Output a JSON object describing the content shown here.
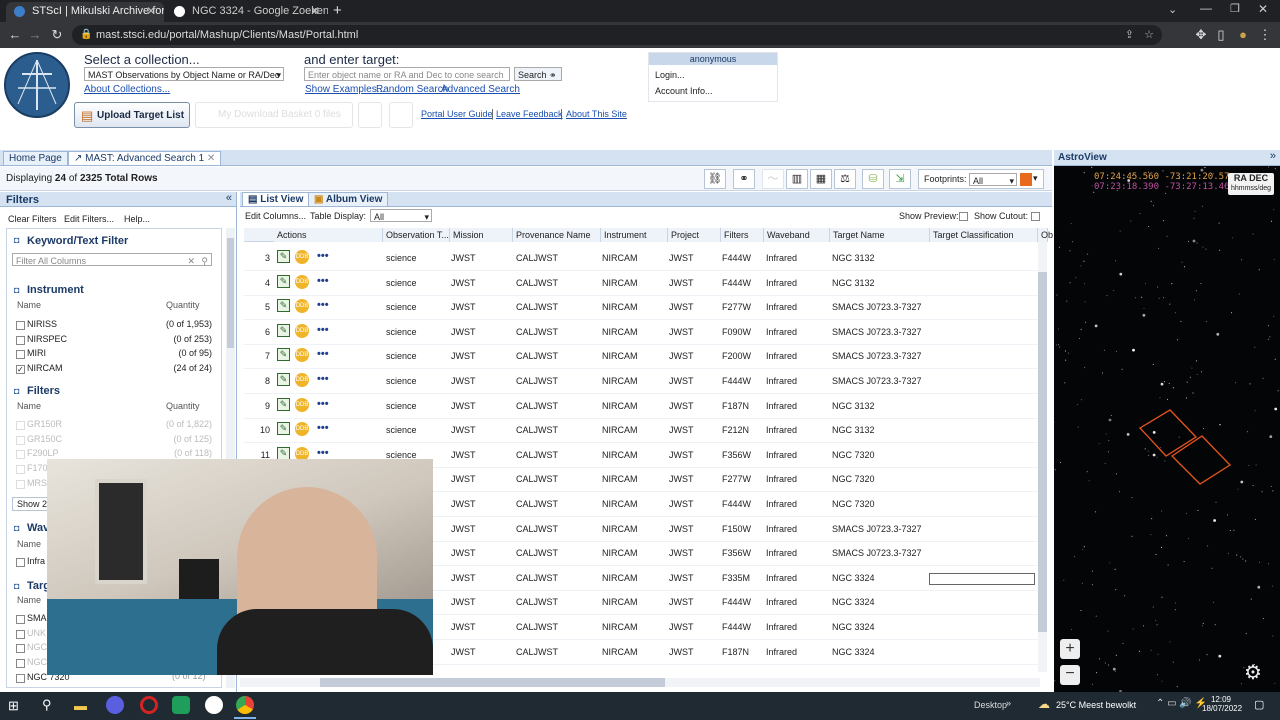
{
  "browser": {
    "tabs": [
      {
        "title": "STScI | Mikulski Archive for Spac",
        "color": "#3d7ec9"
      },
      {
        "title": "NGC 3324 - Google Zoeken",
        "color": "#fff"
      }
    ],
    "url": "mast.stsci.edu/portal/Mashup/Clients/Mast/Portal.html"
  },
  "header": {
    "select_collection_label": "Select a collection...",
    "collection_value": "MAST Observations by Object Name or RA/Dec",
    "about_collections": "About Collections...",
    "enter_target_label": "and enter target:",
    "target_placeholder": "Enter object name or RA and Dec to cone search",
    "search_button": "Search",
    "show_examples": "Show Examples...",
    "random_search": "Random Search",
    "advanced_search": "Advanced Search",
    "upload_button": "Upload Target List",
    "download_basket": "My Download Basket",
    "basket_count": "0 files",
    "links": [
      "Portal User Guide",
      "Leave Feedback",
      "About This Site"
    ],
    "account": {
      "user": "anonymous",
      "login": "Login...",
      "account_info": "Account Info..."
    }
  },
  "tabs": {
    "home": "Home Page",
    "search": "MAST: Advanced Search 1"
  },
  "results": {
    "display_prefix": "Displaying",
    "shown": "24",
    "of": "of",
    "total": "2325",
    "suffix": "Total Rows",
    "footprints_label": "Footprints:",
    "footprints_value": "All"
  },
  "filters": {
    "title": "Filters",
    "clear": "Clear Filters",
    "edit": "Edit Filters...",
    "help": "Help...",
    "keyword_title": "Keyword/Text Filter",
    "keyword_placeholder": "Filter All Columns",
    "name_label": "Name",
    "quantity_label": "Quantity",
    "instrument_title": "Instrument",
    "instruments": [
      {
        "name": "NIRISS",
        "qty": "(0 of 1,953)",
        "checked": false
      },
      {
        "name": "NIRSPEC",
        "qty": "(0 of 253)",
        "checked": false
      },
      {
        "name": "MIRI",
        "qty": "(0 of 95)",
        "checked": false
      },
      {
        "name": "NIRCAM",
        "qty": "(24 of 24)",
        "checked": true
      }
    ],
    "filters_title": "Filters",
    "filter_items": [
      {
        "name": "GR150R",
        "qty": "(0 of 1,822)"
      },
      {
        "name": "GR150C",
        "qty": "(0 of 125)"
      },
      {
        "name": "F290LP",
        "qty": "(0 of 118)"
      },
      {
        "name": "F170",
        "qty": ""
      },
      {
        "name": "MRS",
        "qty": ""
      }
    ],
    "show_more": "Show 2",
    "waveband_title": "Wav",
    "waveband_item": "Infra",
    "target_title": "Targ",
    "target_items": [
      "SMAC",
      "UNK",
      "NGC",
      "NGC",
      "NGC 7320"
    ],
    "target_qty": "(0 of 12)"
  },
  "grid": {
    "list_view": "List View",
    "album_view": "Album View",
    "edit_columns": "Edit Columns...",
    "table_display": "Table Display:",
    "table_display_value": "All",
    "show_preview": "Show Preview:",
    "show_cutout": "Show Cutout:",
    "columns": [
      "Actions",
      "Observation T...",
      "Mission",
      "Provenance Name",
      "Instrument",
      "Project",
      "Filters",
      "Waveband",
      "Target Name",
      "Target Classification",
      "Ob"
    ],
    "rows": [
      {
        "n": "3",
        "type": "science",
        "mission": "JWST",
        "prov": "CALJWST",
        "inst": "NIRCAM",
        "proj": "JWST",
        "filt": "F444W",
        "wave": "Infrared",
        "target": "NGC 3132"
      },
      {
        "n": "4",
        "type": "science",
        "mission": "JWST",
        "prov": "CALJWST",
        "inst": "NIRCAM",
        "proj": "JWST",
        "filt": "F444W",
        "wave": "Infrared",
        "target": "NGC 3132"
      },
      {
        "n": "5",
        "type": "science",
        "mission": "JWST",
        "prov": "CALJWST",
        "inst": "NIRCAM",
        "proj": "JWST",
        "filt": "F277W",
        "wave": "Infrared",
        "target": "SMACS J0723.3-7327"
      },
      {
        "n": "6",
        "type": "science",
        "mission": "JWST",
        "prov": "CALJWST",
        "inst": "NIRCAM",
        "proj": "JWST",
        "filt": "F090W",
        "wave": "Infrared",
        "target": "SMACS J0723.3-7327"
      },
      {
        "n": "7",
        "type": "science",
        "mission": "JWST",
        "prov": "CALJWST",
        "inst": "NIRCAM",
        "proj": "JWST",
        "filt": "F200W",
        "wave": "Infrared",
        "target": "SMACS J0723.3-7327"
      },
      {
        "n": "8",
        "type": "science",
        "mission": "JWST",
        "prov": "CALJWST",
        "inst": "NIRCAM",
        "proj": "JWST",
        "filt": "F444W",
        "wave": "Infrared",
        "target": "SMACS J0723.3-7327"
      },
      {
        "n": "9",
        "type": "science",
        "mission": "JWST",
        "prov": "CALJWST",
        "inst": "NIRCAM",
        "proj": "JWST",
        "filt": "F187N",
        "wave": "Infrared",
        "target": "NGC 3132"
      },
      {
        "n": "10",
        "type": "science",
        "mission": "JWST",
        "prov": "CALJWST",
        "inst": "NIRCAM",
        "proj": "JWST",
        "filt": "F212N",
        "wave": "Infrared",
        "target": "NGC 3132"
      },
      {
        "n": "11",
        "type": "science",
        "mission": "JWST",
        "prov": "CALJWST",
        "inst": "NIRCAM",
        "proj": "JWST",
        "filt": "F356W",
        "wave": "Infrared",
        "target": "NGC 7320"
      },
      {
        "n": "",
        "type": "",
        "mission": "JWST",
        "prov": "CALJWST",
        "inst": "NIRCAM",
        "proj": "JWST",
        "filt": "F277W",
        "wave": "Infrared",
        "target": "NGC 7320"
      },
      {
        "n": "",
        "type": "",
        "mission": "JWST",
        "prov": "CALJWST",
        "inst": "NIRCAM",
        "proj": "JWST",
        "filt": "F444W",
        "wave": "Infrared",
        "target": "NGC 7320"
      },
      {
        "n": "",
        "type": "",
        "mission": "JWST",
        "prov": "CALJWST",
        "inst": "NIRCAM",
        "proj": "JWST",
        "filt": "F150W",
        "wave": "Infrared",
        "target": "SMACS J0723.3-7327"
      },
      {
        "n": "",
        "type": "",
        "mission": "JWST",
        "prov": "CALJWST",
        "inst": "NIRCAM",
        "proj": "JWST",
        "filt": "F356W",
        "wave": "Infrared",
        "target": "SMACS J0723.3-7327"
      },
      {
        "n": "",
        "type": "",
        "mission": "JWST",
        "prov": "CALJWST",
        "inst": "NIRCAM",
        "proj": "JWST",
        "filt": "F335M",
        "wave": "Infrared",
        "target": "NGC 3324"
      },
      {
        "n": "",
        "type": "",
        "mission": "JWST",
        "prov": "CALJWST",
        "inst": "NIRCAM",
        "proj": "JWST",
        "filt": "F444W",
        "wave": "Infrared",
        "target": "NGC 3324"
      },
      {
        "n": "",
        "type": "",
        "mission": "JWST",
        "prov": "CALJWST",
        "inst": "NIRCAM",
        "proj": "JWST",
        "filt": "F444W",
        "wave": "Infrared",
        "target": "NGC 3324"
      },
      {
        "n": "",
        "type": "",
        "mission": "JWST",
        "prov": "CALJWST",
        "inst": "NIRCAM",
        "proj": "JWST",
        "filt": "F187N",
        "wave": "Infrared",
        "target": "NGC 3324"
      }
    ]
  },
  "astroview": {
    "title": "AstroView",
    "coord1": "07:24:45.560 -73:21:20.57",
    "coord2": "07:23:18.390 -73:27:13.46",
    "radec": "RA DEC",
    "units": "hhmmss/deg"
  },
  "taskbar": {
    "desktop": "Desktop",
    "weather": "25°C  Meest bewolkt",
    "time": "12:09",
    "date": "18/07/2022"
  }
}
